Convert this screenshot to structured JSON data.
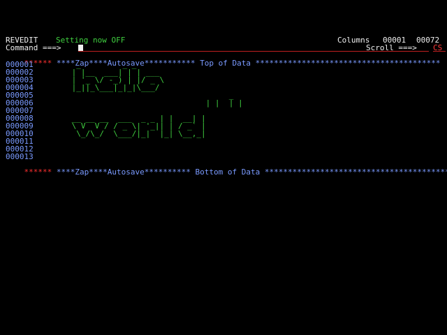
{
  "header": {
    "panel_name": "REVEDIT",
    "message": "Setting now OFF",
    "columns_label": "Columns",
    "col_start": "00001",
    "col_end": "00072"
  },
  "command": {
    "label": "Command ===>",
    "value": "",
    "scroll_label": "Scroll ===>",
    "scroll_value": "CS"
  },
  "top_marker": {
    "stars": "******",
    "text": " ****Zap****Autosave*********** Top of Data ****************************************"
  },
  "bottom_marker": {
    "stars": "******",
    "text": " ****Zap****Autosave********** Bottom of Data *****************************************"
  },
  "line_numbers": [
    "000001",
    "000002",
    "000003",
    "000004",
    "000005",
    "000006",
    "000007",
    "000008",
    "000009",
    "000010",
    "000011",
    "000012",
    "000013"
  ],
  "art_lines": [
    "  _         _ _",
    " | |__  ___| | | ___",
    " | '_ \\/ -_) | |/ _ \\",
    " |_||_\\___|_|_|\\___/",
    "                                   _",
    "                              | |  | |",
    "",
    " __ __ __  ___  _ _ | |  __| |",
    " \\ V  V / / _ \\| '_|| | / _` |",
    "  \\_/\\_/  \\___/|_|  |_| \\__,_|",
    "",
    "",
    ""
  ]
}
